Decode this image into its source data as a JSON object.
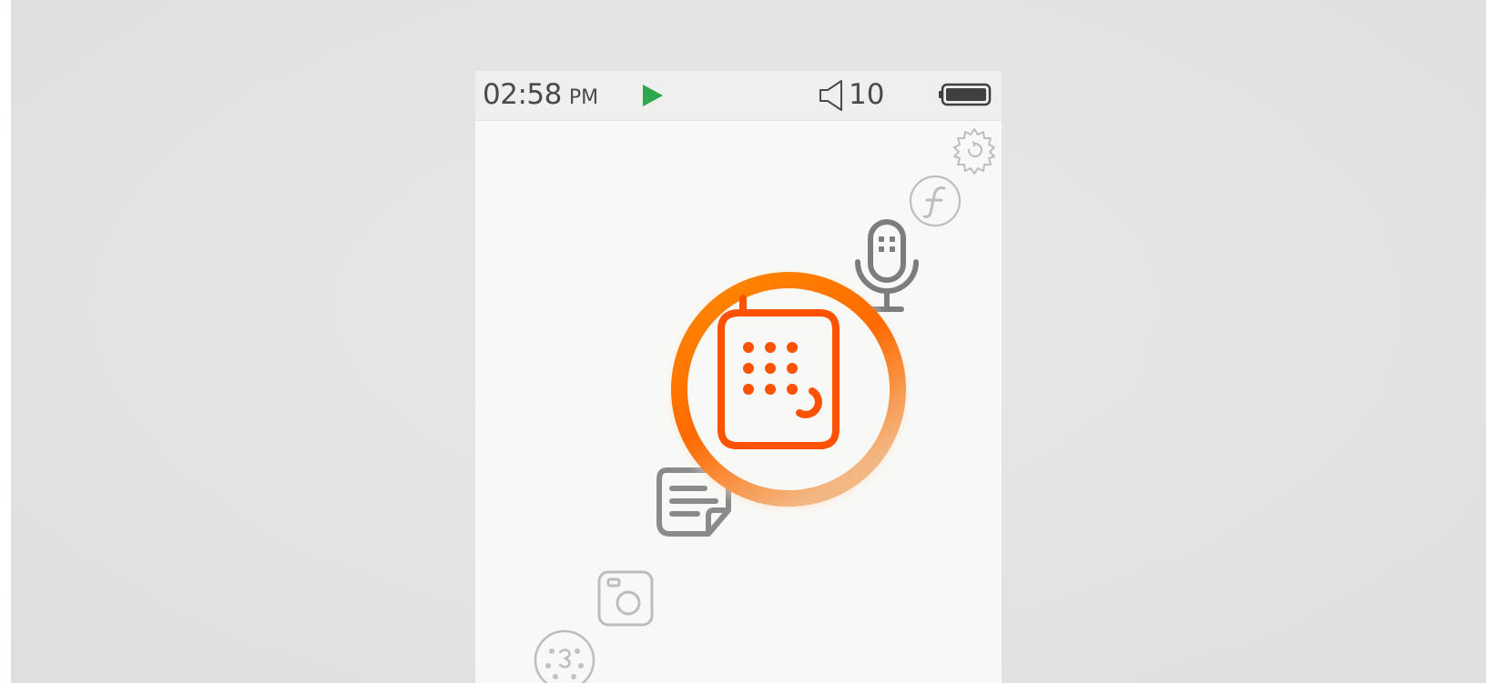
{
  "status_bar": {
    "time": "02:58",
    "am_pm": "PM",
    "volume": "10",
    "play_state": "playing",
    "battery": "full"
  },
  "colors": {
    "accent": "#ff5200",
    "ring": "#ff8200",
    "play": "#2ea84e",
    "text": "#4a4a4a"
  },
  "menu": {
    "selected": "phone-dialer",
    "items": [
      "settings",
      "flash",
      "voice-recorder",
      "phone-dialer",
      "notes",
      "camera",
      "dice-game"
    ]
  }
}
